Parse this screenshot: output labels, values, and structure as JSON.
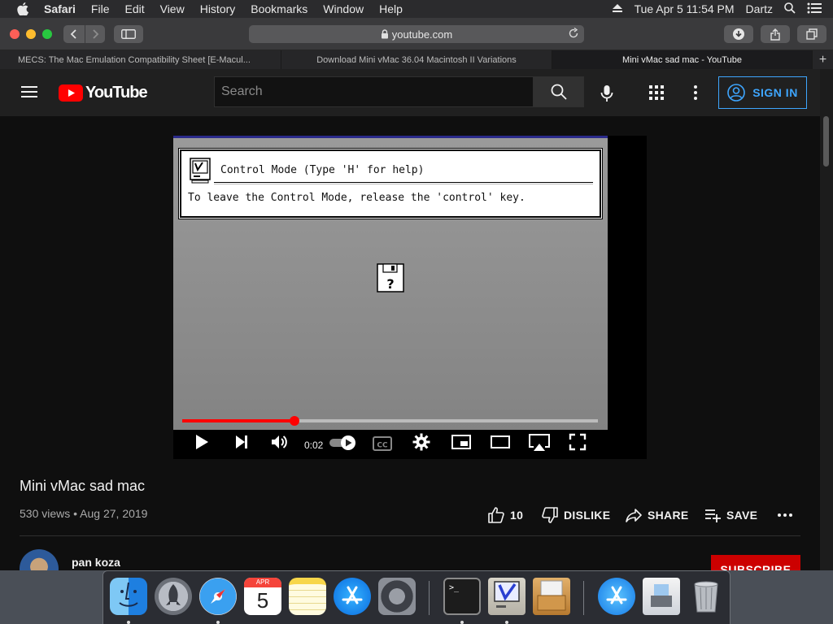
{
  "menubar": {
    "app": "Safari",
    "items": [
      "File",
      "Edit",
      "View",
      "History",
      "Bookmarks",
      "Window",
      "Help"
    ],
    "datetime": "Tue Apr 5  11:54 PM",
    "user": "Dartz"
  },
  "toolbar": {
    "url": "youtube.com"
  },
  "tabs": [
    {
      "label": "MECS: The Mac Emulation Compatibility Sheet [E-Macul..."
    },
    {
      "label": "Download Mini vMac 36.04 Macintosh II Variations"
    },
    {
      "label": "Mini vMac sad mac - YouTube"
    }
  ],
  "youtube": {
    "logo_text": "YouTube",
    "search_placeholder": "Search",
    "sign_in": "SIGN IN"
  },
  "video": {
    "dialog_title": "Control Mode (Type 'H' for help)",
    "dialog_message": "To leave the Control Mode, release the 'control' key.",
    "time": "0:02",
    "progress_fraction": 0.27,
    "cc_label": "CC"
  },
  "meta": {
    "title": "Mini vMac sad mac",
    "views_date": "530 views • Aug 27, 2019",
    "likes": "10",
    "dislike": "DISLIKE",
    "share": "SHARE",
    "save": "SAVE",
    "channel": "pan koza",
    "subscribe": "SUBSCRIBE"
  },
  "dock": {
    "apps": [
      "finder-icon",
      "launchpad-icon",
      "safari-icon",
      "calendar-icon",
      "notes-icon",
      "app-store-icon",
      "system-preferences-icon",
      "terminal-icon",
      "mini-vmac-icon",
      "archive-utility-icon",
      "app-store-folder-icon",
      "preview-icon",
      "trash-icon"
    ],
    "calendar_month": "APR",
    "calendar_day": "5"
  }
}
